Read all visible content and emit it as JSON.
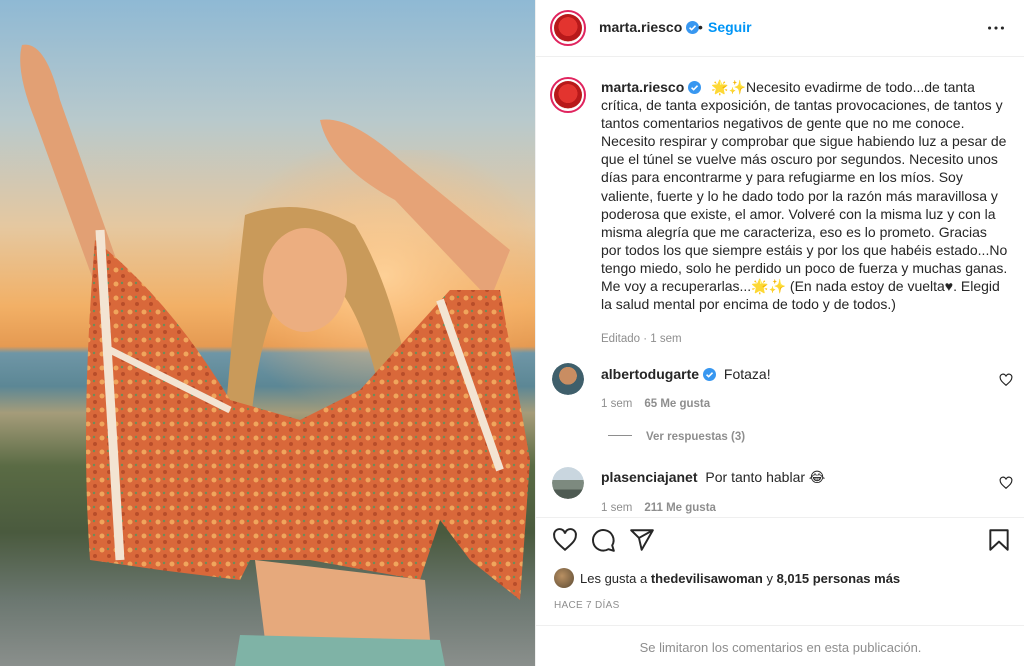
{
  "post": {
    "author": "marta.riesco",
    "follow_label": "Seguir",
    "separator": "•",
    "caption_prefix": "🌟✨",
    "caption": "Necesito evadirme de todo...de tanta crítica, de tanta exposición, de tantas provocaciones, de tantos y tantos comentarios negativos de gente que no me conoce. Necesito respirar y comprobar que sigue habiendo luz a pesar de que el túnel se vuelve más oscuro por segundos. Necesito unos días para encontrarme y para refugiarme en los míos. Soy valiente, fuerte y lo he dado todo por la razón más maravillosa y poderosa que existe, el amor. Volveré con la misma luz y con la misma alegría que me caracteriza, eso es lo prometo. Gracias por todos los que siempre estáis y por los que habéis estado...No tengo miedo, solo he perdido un poco de fuerza y muchas ganas. Me voy a recuperarlas...🌟✨ (En nada estoy de vuelta♥. Elegid la salud mental por encima de todo y de todos.)",
    "edited": "Editado · 1 sem"
  },
  "comments": [
    {
      "user": "albertodugarte",
      "text": "Fotaza!",
      "time": "1 sem",
      "likes": "65 Me gusta",
      "replies": "Ver respuestas (3)"
    },
    {
      "user": "plasenciajanet",
      "text": "Por tanto hablar 😂",
      "time": "1 sem",
      "likes": "211 Me gusta"
    }
  ],
  "likes_bar": {
    "prefix": "Les gusta a",
    "user": "thedevilisawoman",
    "middle": "y",
    "count": "8,015 personas más"
  },
  "date": "HACE 7 DÍAS",
  "comments_limited": "Se limitaron los comentarios en esta publicación.",
  "icons": {
    "more": "more-horizontal-icon",
    "like": "heart-icon",
    "comment": "comment-icon",
    "share": "share-icon",
    "save": "bookmark-icon",
    "verified": "verified-badge-icon"
  },
  "colors": {
    "link_blue": "#0095f6",
    "verified_blue": "#3897f0",
    "muted": "#8e8e8e",
    "story_ring": "#e0245e"
  }
}
